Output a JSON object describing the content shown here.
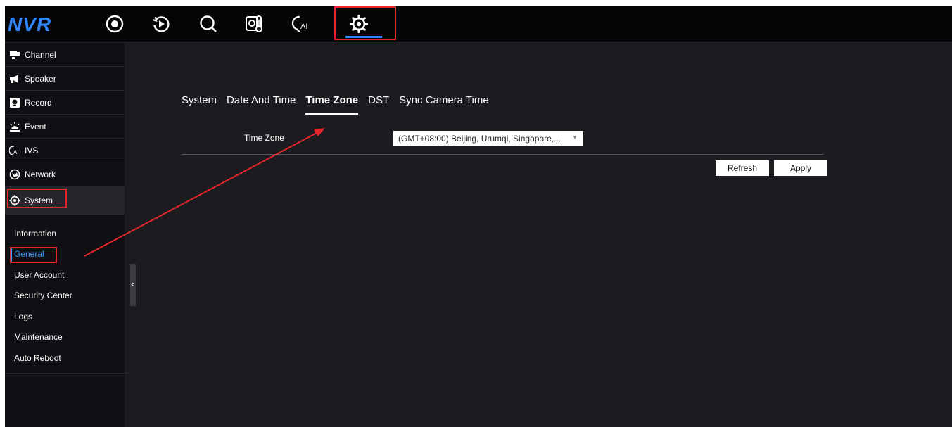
{
  "app": {
    "logo": "NVR"
  },
  "topbar": {
    "icons": [
      {
        "name": "live-view-icon"
      },
      {
        "name": "playback-icon"
      },
      {
        "name": "search-icon"
      },
      {
        "name": "thermal-icon"
      },
      {
        "name": "ai-icon"
      },
      {
        "name": "settings-icon",
        "active": true
      }
    ]
  },
  "sidebar": {
    "items": [
      {
        "label": "Channel",
        "icon": "channel-icon"
      },
      {
        "label": "Speaker",
        "icon": "speaker-icon"
      },
      {
        "label": "Record",
        "icon": "record-icon"
      },
      {
        "label": "Event",
        "icon": "event-icon"
      },
      {
        "label": "IVS",
        "icon": "ivs-icon"
      },
      {
        "label": "Network",
        "icon": "network-icon"
      },
      {
        "label": "System",
        "icon": "system-gear-icon",
        "active": true
      }
    ],
    "system_sub": [
      {
        "label": "Information"
      },
      {
        "label": "General",
        "selected": true
      },
      {
        "label": "User Account"
      },
      {
        "label": "Security Center"
      },
      {
        "label": "Logs"
      },
      {
        "label": "Maintenance"
      },
      {
        "label": "Auto Reboot"
      }
    ],
    "collapse_label": "<"
  },
  "main": {
    "tabs": [
      {
        "label": "System"
      },
      {
        "label": "Date And Time"
      },
      {
        "label": "Time Zone",
        "active": true
      },
      {
        "label": "DST"
      },
      {
        "label": "Sync Camera Time"
      }
    ],
    "time_zone": {
      "label": "Time Zone",
      "value": "(GMT+08:00) Beijing, Urumqi, Singapore,..."
    },
    "buttons": {
      "refresh": "Refresh",
      "apply": "Apply"
    }
  },
  "colors": {
    "accent": "#2f86ff",
    "highlight": "#e3262b",
    "background": "#1c1c20",
    "sidebar": "#101014"
  }
}
